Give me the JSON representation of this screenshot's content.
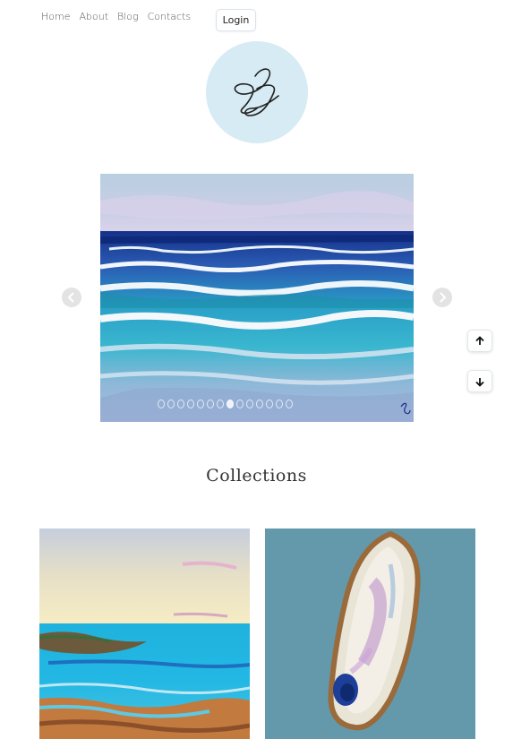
{
  "nav": {
    "items": [
      {
        "label": "Home"
      },
      {
        "label": "About"
      },
      {
        "label": "Blog"
      },
      {
        "label": "Contacts"
      }
    ],
    "login_label": "Login"
  },
  "logo": {
    "background": "#d6ebf3"
  },
  "slider": {
    "slide_count": 14,
    "active_index": 7
  },
  "collections": {
    "title": "Collections"
  },
  "icons": {
    "prev": "chevron-left-icon",
    "next": "chevron-right-icon",
    "up": "arrow-up-icon",
    "down": "arrow-down-icon"
  }
}
